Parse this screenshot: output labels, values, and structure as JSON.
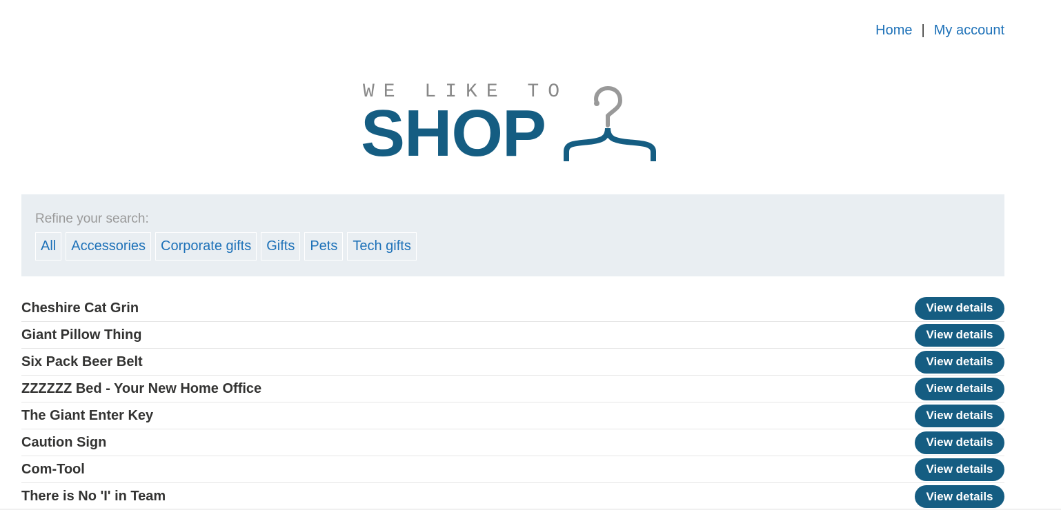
{
  "nav": {
    "home": "Home",
    "separator": "|",
    "my_account": "My account"
  },
  "logo": {
    "tagline": "WE LIKE TO",
    "word": "SHOP",
    "icon": "hanger-icon"
  },
  "filter": {
    "label": "Refine your search:",
    "categories": [
      "All",
      "Accessories",
      "Corporate gifts",
      "Gifts",
      "Pets",
      "Tech gifts"
    ]
  },
  "products": [
    {
      "name": "Cheshire Cat Grin",
      "action": "View details"
    },
    {
      "name": "Giant Pillow Thing",
      "action": "View details"
    },
    {
      "name": "Six Pack Beer Belt",
      "action": "View details"
    },
    {
      "name": "ZZZZZZ Bed - Your New Home Office",
      "action": "View details"
    },
    {
      "name": "The Giant Enter Key",
      "action": "View details"
    },
    {
      "name": "Caution Sign",
      "action": "View details"
    },
    {
      "name": "Com-Tool",
      "action": "View details"
    },
    {
      "name": "There is No 'I' in Team",
      "action": "View details"
    }
  ],
  "colors": {
    "brand": "#155d82",
    "link": "#1d71b8",
    "filter_bg": "#e9eef2"
  }
}
